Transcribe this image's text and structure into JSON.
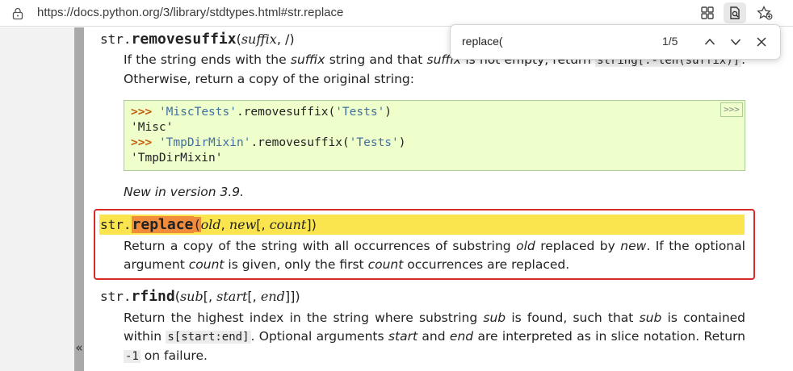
{
  "browser": {
    "url": "https://docs.python.org/3/library/stdtypes.html#str.replace",
    "icons": [
      "lock-icon",
      "extensions-icon",
      "page-find-icon",
      "favorites-icon"
    ]
  },
  "findbar": {
    "query": "replace(",
    "count": "1/5"
  },
  "sidebar": {
    "collapse_label": "«"
  },
  "removesuffix": {
    "cls": "str.",
    "name": "removesuffix",
    "open": "(",
    "arg": "suffix",
    "rest": ", /)",
    "desc_1": "If the string ends with the",
    "desc_arg": "suffix",
    "desc_2": "string and that",
    "desc_arg2": "suffix",
    "desc_3": "is not empty, return",
    "desc_code": "string[:-len(suffix)]",
    "desc_4": ". Otherwise, return a copy of the original string:",
    "code": {
      "line1_prompt": ">>>",
      "line1_str": "'MiscTests'",
      "line1_call": ".removesuffix(",
      "line1_arg": "'Tests'",
      "line1_end": ")",
      "line2": "'Misc'",
      "line3_prompt": ">>>",
      "line3_str": "'TmpDirMixin'",
      "line3_call": ".removesuffix(",
      "line3_arg": "'Tests'",
      "line3_end": ")",
      "line4": "'TmpDirMixin'",
      "copy_label": ">>>"
    },
    "version": "New in version 3.9."
  },
  "replace": {
    "cls": "str.",
    "name": "replace",
    "open": "(",
    "arg1": "old",
    "sep1": ", ",
    "arg2": "new",
    "opt_open": "[, ",
    "arg3": "count",
    "close": "])",
    "desc_1": "Return a copy of the string with all occurrences of substring",
    "desc_old": "old",
    "desc_2": "replaced by",
    "desc_new": "new",
    "desc_3": ". If the optional argument",
    "desc_count": "count",
    "desc_4": "is given, only the first",
    "desc_count2": "count",
    "desc_5": "occurrences are replaced."
  },
  "rfind": {
    "cls": "str.",
    "name": "rfind",
    "open": "(",
    "arg1": "sub",
    "opt1": "[, ",
    "arg2": "start",
    "opt2": "[, ",
    "arg3": "end",
    "close": "]])",
    "desc_1": "Return the highest index in the string where substring",
    "desc_sub": "sub",
    "desc_2": "is found, such that",
    "desc_sub2": "sub",
    "desc_3": "is contained within",
    "desc_code": "s[start:end]",
    "desc_4": ". Optional arguments",
    "desc_start": "start",
    "desc_5": "and",
    "desc_end": "end",
    "desc_6": "are interpreted as in slice notation. Return",
    "desc_code2": "-1",
    "desc_7": "on failure."
  }
}
